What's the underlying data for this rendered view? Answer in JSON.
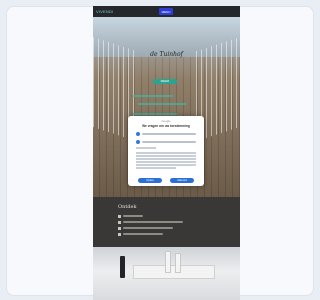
{
  "app": {
    "logo": "VIVENDI",
    "menu_label": "MENU"
  },
  "hero": {
    "title": "de Tuinhof",
    "cta": "MEER"
  },
  "section": {
    "heading": "Ontdek"
  },
  "consent": {
    "brand": "Google",
    "heading": "We vragen om uw toestemming",
    "accept_label": "Akkoord",
    "manage_label": "Opties"
  },
  "colors": {
    "accent": "#2e6fd6",
    "teal": "#2aa390",
    "topbar": "#24282c"
  }
}
